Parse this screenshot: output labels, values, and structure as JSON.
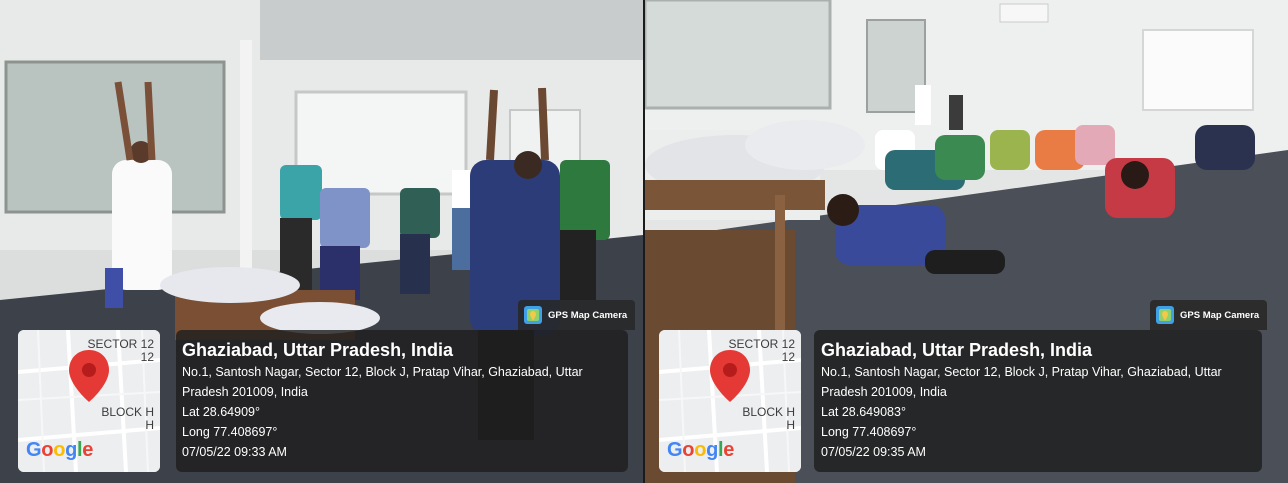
{
  "photos": [
    {
      "badge": "GPS Map Camera",
      "map": {
        "sector_label": "SECTOR 12\n12",
        "block_label": "BLOCK H\nH",
        "logo": "Google"
      },
      "city": "Ghaziabad, Uttar Pradesh, India",
      "address": "No.1, Santosh Nagar, Sector 12, Block J, Pratap Vihar, Ghaziabad, Uttar Pradesh 201009, India",
      "lat": "Lat 28.64909°",
      "long": "Long 77.408697°",
      "datetime": "07/05/22 09:33 AM"
    },
    {
      "badge": "GPS Map Camera",
      "map": {
        "sector_label": "SECTOR 12\n12",
        "block_label": "BLOCK H\nH",
        "logo": "Google"
      },
      "city": "Ghaziabad, Uttar Pradesh, India",
      "address": "No.1, Santosh Nagar, Sector 12, Block J, Pratap Vihar, Ghaziabad, Uttar Pradesh 201009, India",
      "lat": "Lat 28.649083°",
      "long": "Long 77.408697°",
      "datetime": "07/05/22 09:35 AM"
    }
  ],
  "colors": {
    "pin": "#e53935",
    "panel": "#1e1e1e",
    "floor": "#3b3f48",
    "wall": "#e9ebea"
  }
}
